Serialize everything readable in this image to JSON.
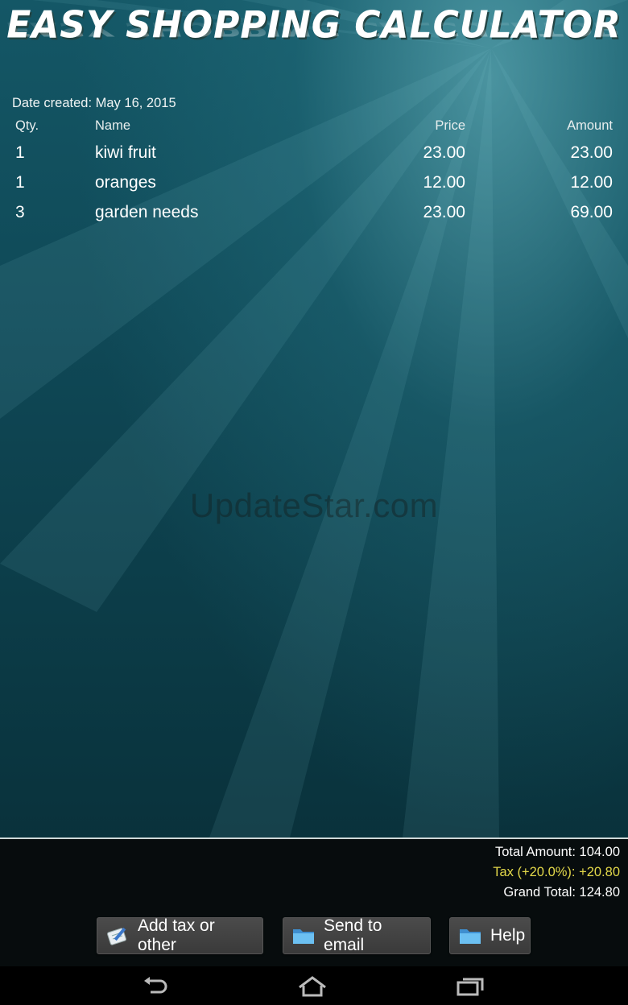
{
  "app": {
    "title": "EASY SHOPPING CALCULATOR",
    "date_created": "Date created: May 16, 2015"
  },
  "table": {
    "headers": {
      "qty": "Qty.",
      "name": "Name",
      "price": "Price",
      "amount": "Amount"
    },
    "rows": [
      {
        "qty": "1",
        "name": "kiwi fruit",
        "price": "23.00",
        "amount": "23.00"
      },
      {
        "qty": "1",
        "name": "oranges",
        "price": "12.00",
        "amount": "12.00"
      },
      {
        "qty": "3",
        "name": "garden needs",
        "price": "23.00",
        "amount": "69.00"
      }
    ]
  },
  "watermark": "UpdateStar.com",
  "totals": {
    "total_amount": "Total Amount: 104.00",
    "tax": "Tax (+20.0%): +20.80",
    "grand_total": "Grand Total: 124.80"
  },
  "buttons": {
    "add_tax": {
      "label": "Add tax or other",
      "icon": "notepad-pencil-icon"
    },
    "send_email": {
      "label": "Send to email",
      "icon": "folder-icon"
    },
    "help": {
      "label": "Help",
      "icon": "folder-icon"
    }
  },
  "navbar": {
    "icons": [
      "back-icon",
      "home-icon",
      "recent-apps-icon"
    ]
  },
  "colors": {
    "background": "#0f4856",
    "tax_text": "#e4d94a",
    "footer": "#070c0d"
  }
}
